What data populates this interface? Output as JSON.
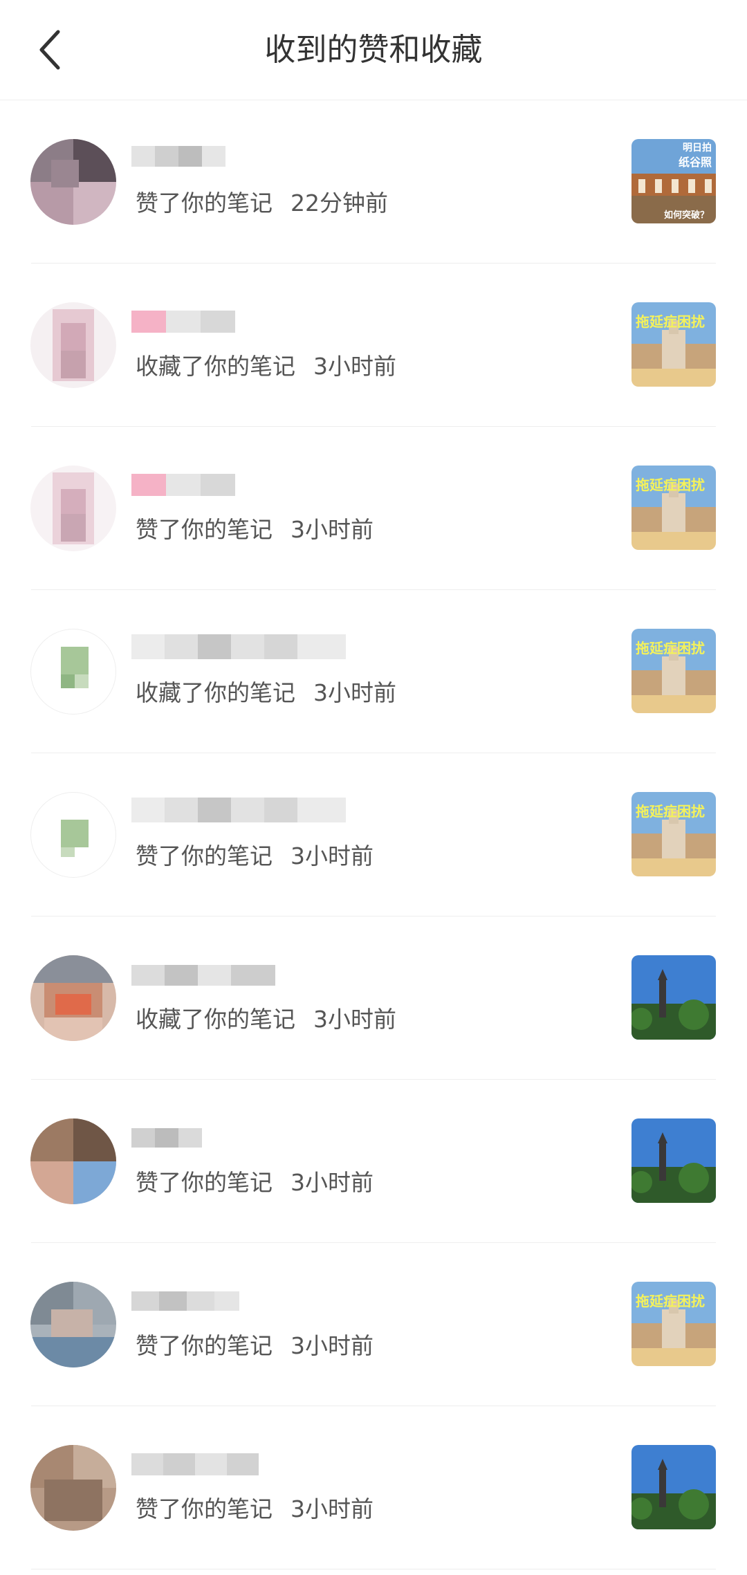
{
  "header": {
    "title": "收到的赞和收藏"
  },
  "notifications": [
    {
      "action": "赞了你的笔记",
      "time": "22分钟前",
      "thumb_caption_top": "明日拍",
      "thumb_caption_mid": "纸谷照",
      "thumb_caption_bottom": "如何突破？"
    },
    {
      "action": "收藏了你的笔记",
      "time": "3小时前",
      "thumb_caption_top": "拖延症困扰"
    },
    {
      "action": "赞了你的笔记",
      "time": "3小时前",
      "thumb_caption_top": "拖延症困扰"
    },
    {
      "action": "收藏了你的笔记",
      "time": "3小时前",
      "thumb_caption_top": "拖延症困扰"
    },
    {
      "action": "赞了你的笔记",
      "time": "3小时前",
      "thumb_caption_top": "拖延症困扰"
    },
    {
      "action": "收藏了你的笔记",
      "time": "3小时前"
    },
    {
      "action": "赞了你的笔记",
      "time": "3小时前"
    },
    {
      "action": "赞了你的笔记",
      "time": "3小时前",
      "thumb_caption_top": "拖延症困扰"
    },
    {
      "action": "赞了你的笔记",
      "time": "3小时前"
    }
  ],
  "colors": {
    "divider": "#eeeeee",
    "text_primary": "#333333",
    "text_secondary": "#555555",
    "thumb_caption": "#f5f25a"
  },
  "icons": {
    "back": "chevron-left-icon"
  }
}
